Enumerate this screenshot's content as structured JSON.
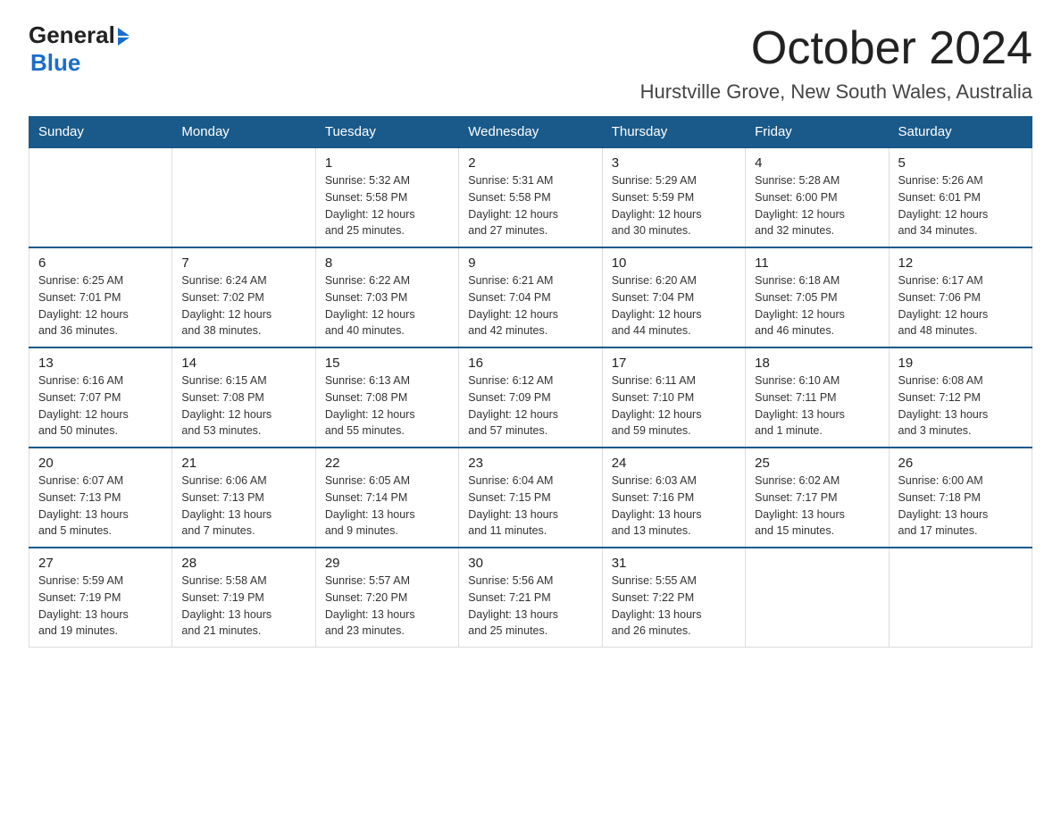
{
  "header": {
    "logo_general": "General",
    "logo_blue": "Blue",
    "month_title": "October 2024",
    "location": "Hurstville Grove, New South Wales, Australia"
  },
  "days_of_week": [
    "Sunday",
    "Monday",
    "Tuesday",
    "Wednesday",
    "Thursday",
    "Friday",
    "Saturday"
  ],
  "weeks": [
    [
      {
        "day": "",
        "info": ""
      },
      {
        "day": "",
        "info": ""
      },
      {
        "day": "1",
        "info": "Sunrise: 5:32 AM\nSunset: 5:58 PM\nDaylight: 12 hours\nand 25 minutes."
      },
      {
        "day": "2",
        "info": "Sunrise: 5:31 AM\nSunset: 5:58 PM\nDaylight: 12 hours\nand 27 minutes."
      },
      {
        "day": "3",
        "info": "Sunrise: 5:29 AM\nSunset: 5:59 PM\nDaylight: 12 hours\nand 30 minutes."
      },
      {
        "day": "4",
        "info": "Sunrise: 5:28 AM\nSunset: 6:00 PM\nDaylight: 12 hours\nand 32 minutes."
      },
      {
        "day": "5",
        "info": "Sunrise: 5:26 AM\nSunset: 6:01 PM\nDaylight: 12 hours\nand 34 minutes."
      }
    ],
    [
      {
        "day": "6",
        "info": "Sunrise: 6:25 AM\nSunset: 7:01 PM\nDaylight: 12 hours\nand 36 minutes."
      },
      {
        "day": "7",
        "info": "Sunrise: 6:24 AM\nSunset: 7:02 PM\nDaylight: 12 hours\nand 38 minutes."
      },
      {
        "day": "8",
        "info": "Sunrise: 6:22 AM\nSunset: 7:03 PM\nDaylight: 12 hours\nand 40 minutes."
      },
      {
        "day": "9",
        "info": "Sunrise: 6:21 AM\nSunset: 7:04 PM\nDaylight: 12 hours\nand 42 minutes."
      },
      {
        "day": "10",
        "info": "Sunrise: 6:20 AM\nSunset: 7:04 PM\nDaylight: 12 hours\nand 44 minutes."
      },
      {
        "day": "11",
        "info": "Sunrise: 6:18 AM\nSunset: 7:05 PM\nDaylight: 12 hours\nand 46 minutes."
      },
      {
        "day": "12",
        "info": "Sunrise: 6:17 AM\nSunset: 7:06 PM\nDaylight: 12 hours\nand 48 minutes."
      }
    ],
    [
      {
        "day": "13",
        "info": "Sunrise: 6:16 AM\nSunset: 7:07 PM\nDaylight: 12 hours\nand 50 minutes."
      },
      {
        "day": "14",
        "info": "Sunrise: 6:15 AM\nSunset: 7:08 PM\nDaylight: 12 hours\nand 53 minutes."
      },
      {
        "day": "15",
        "info": "Sunrise: 6:13 AM\nSunset: 7:08 PM\nDaylight: 12 hours\nand 55 minutes."
      },
      {
        "day": "16",
        "info": "Sunrise: 6:12 AM\nSunset: 7:09 PM\nDaylight: 12 hours\nand 57 minutes."
      },
      {
        "day": "17",
        "info": "Sunrise: 6:11 AM\nSunset: 7:10 PM\nDaylight: 12 hours\nand 59 minutes."
      },
      {
        "day": "18",
        "info": "Sunrise: 6:10 AM\nSunset: 7:11 PM\nDaylight: 13 hours\nand 1 minute."
      },
      {
        "day": "19",
        "info": "Sunrise: 6:08 AM\nSunset: 7:12 PM\nDaylight: 13 hours\nand 3 minutes."
      }
    ],
    [
      {
        "day": "20",
        "info": "Sunrise: 6:07 AM\nSunset: 7:13 PM\nDaylight: 13 hours\nand 5 minutes."
      },
      {
        "day": "21",
        "info": "Sunrise: 6:06 AM\nSunset: 7:13 PM\nDaylight: 13 hours\nand 7 minutes."
      },
      {
        "day": "22",
        "info": "Sunrise: 6:05 AM\nSunset: 7:14 PM\nDaylight: 13 hours\nand 9 minutes."
      },
      {
        "day": "23",
        "info": "Sunrise: 6:04 AM\nSunset: 7:15 PM\nDaylight: 13 hours\nand 11 minutes."
      },
      {
        "day": "24",
        "info": "Sunrise: 6:03 AM\nSunset: 7:16 PM\nDaylight: 13 hours\nand 13 minutes."
      },
      {
        "day": "25",
        "info": "Sunrise: 6:02 AM\nSunset: 7:17 PM\nDaylight: 13 hours\nand 15 minutes."
      },
      {
        "day": "26",
        "info": "Sunrise: 6:00 AM\nSunset: 7:18 PM\nDaylight: 13 hours\nand 17 minutes."
      }
    ],
    [
      {
        "day": "27",
        "info": "Sunrise: 5:59 AM\nSunset: 7:19 PM\nDaylight: 13 hours\nand 19 minutes."
      },
      {
        "day": "28",
        "info": "Sunrise: 5:58 AM\nSunset: 7:19 PM\nDaylight: 13 hours\nand 21 minutes."
      },
      {
        "day": "29",
        "info": "Sunrise: 5:57 AM\nSunset: 7:20 PM\nDaylight: 13 hours\nand 23 minutes."
      },
      {
        "day": "30",
        "info": "Sunrise: 5:56 AM\nSunset: 7:21 PM\nDaylight: 13 hours\nand 25 minutes."
      },
      {
        "day": "31",
        "info": "Sunrise: 5:55 AM\nSunset: 7:22 PM\nDaylight: 13 hours\nand 26 minutes."
      },
      {
        "day": "",
        "info": ""
      },
      {
        "day": "",
        "info": ""
      }
    ]
  ]
}
